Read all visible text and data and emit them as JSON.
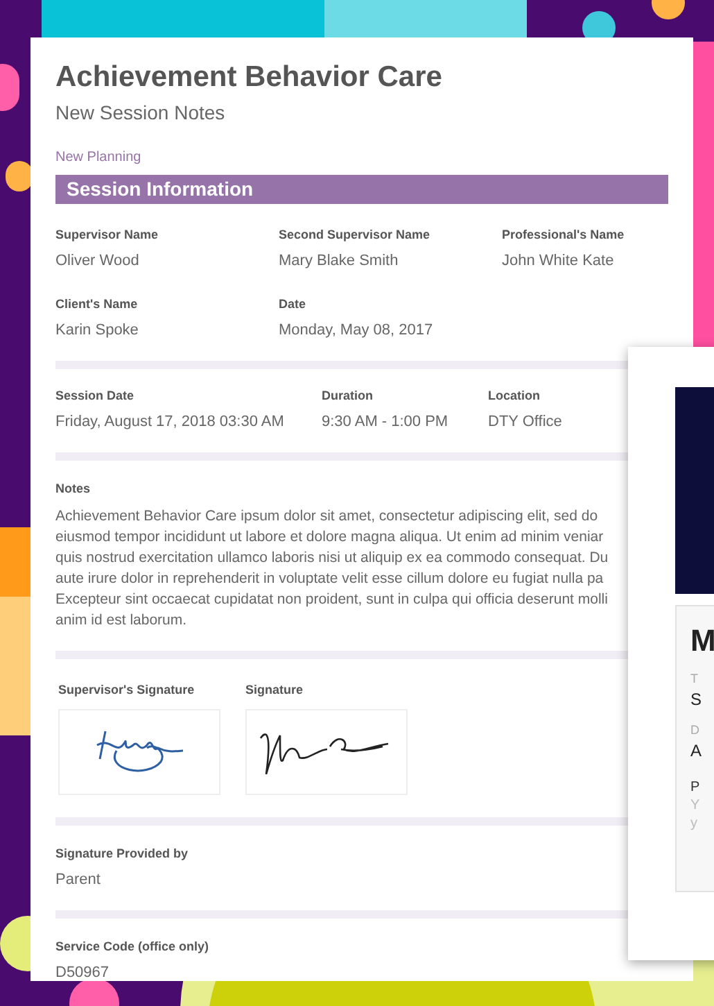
{
  "header": {
    "title": "Achievement Behavior Care",
    "subtitle": "New Session Notes",
    "link": "New Planning"
  },
  "section": {
    "title": "Session Information"
  },
  "field_rows": [
    {
      "fields": [
        {
          "label": "Supervisor Name",
          "value": "Oliver Wood"
        },
        {
          "label": "Second Supervisor Name",
          "value": "Mary Blake Smith"
        },
        {
          "label": "Professional's Name",
          "value": "John White Kate"
        }
      ]
    },
    {
      "fields": [
        {
          "label": "Client's Name",
          "value": "Karin Spoke"
        },
        {
          "label": "Date",
          "value": "Monday, May 08, 2017"
        }
      ]
    }
  ],
  "session_row": {
    "fields": [
      {
        "label": "Session Date",
        "value": "Friday, August 17, 2018 03:30 AM"
      },
      {
        "label": "Duration",
        "value": "9:30 AM - 1:00 PM"
      },
      {
        "label": "Location",
        "value": "DTY Office"
      }
    ]
  },
  "notes": {
    "label": "Notes",
    "lines": [
      "Achievement Behavior Care ipsum dolor sit amet, consectetur adipiscing elit, sed do",
      "eiusmod tempor incididunt ut labore et dolore magna aliqua. Ut enim ad minim veniar",
      "quis nostrud exercitation ullamco laboris nisi ut aliquip ex ea commodo consequat. Du",
      "aute irure dolor in reprehenderit in voluptate velit esse cillum dolore eu fugiat nulla pa",
      "Excepteur sint occaecat cupidatat non proident, sunt in culpa qui officia deserunt molli",
      "anim id est laborum."
    ]
  },
  "signatures": [
    {
      "label": "Supervisor's Signature",
      "kind": "supervisor"
    },
    {
      "label": "Signature",
      "kind": "client"
    }
  ],
  "provided_by": {
    "label": "Signature Provided by",
    "value": "Parent"
  },
  "service_code": {
    "label": "Service Code (office only)",
    "value": "D50967"
  },
  "side_card": {
    "heading": "M",
    "lines": [
      {
        "text": "T",
        "kind": "label"
      },
      {
        "text": "S",
        "kind": "value"
      },
      {
        "text": "D",
        "kind": "label"
      },
      {
        "text": "A",
        "kind": "value"
      },
      {
        "text": "P",
        "kind": "title"
      },
      {
        "text": "Y",
        "kind": "muted"
      },
      {
        "text": "y",
        "kind": "muted"
      }
    ]
  }
}
